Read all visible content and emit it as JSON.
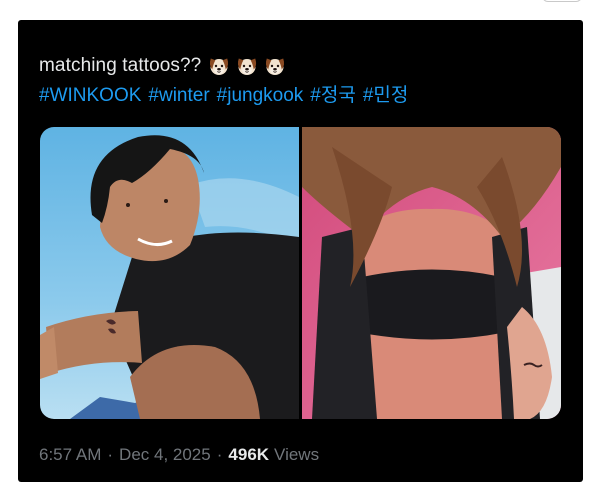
{
  "tweet": {
    "caption": "matching tattoos??",
    "emojis": [
      "dog-face-emoji",
      "dog-face-emoji",
      "dog-face-emoji"
    ],
    "hashtags": [
      "#WINKOOK",
      "#winter",
      "#jungkook",
      "#정국",
      "#민정"
    ],
    "media": [
      {
        "subject": "man-with-arm-tattoo-photo"
      },
      {
        "subject": "woman-back-arm-tattoo-photo"
      }
    ],
    "time": "6:57 AM",
    "separator": "·",
    "date": "Dec 4, 2025",
    "views_count": "496K",
    "views_label": "Views"
  },
  "colors": {
    "card_background": "#000000",
    "text_primary": "#e7e9ea",
    "text_secondary": "#71767b",
    "link": "#1d9bf0"
  }
}
